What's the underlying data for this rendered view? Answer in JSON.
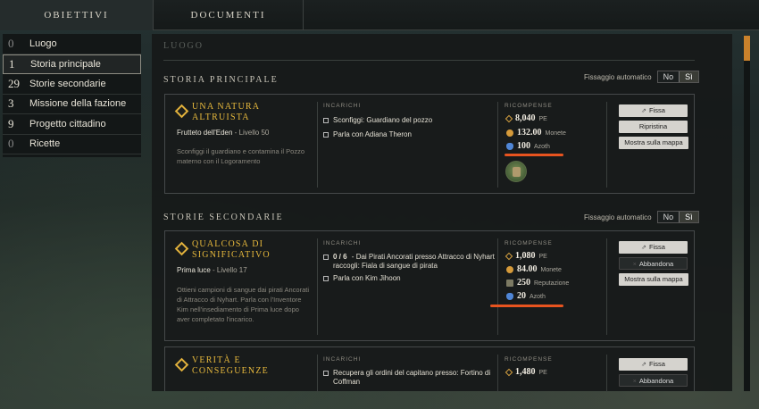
{
  "tabs": {
    "objectives": "OBIETTIVI",
    "documents": "DOCUMENTI"
  },
  "sidebar": {
    "items": [
      {
        "count": "0",
        "label": "Luogo"
      },
      {
        "count": "1",
        "label": "Storia principale"
      },
      {
        "count": "29",
        "label": "Storie secondarie"
      },
      {
        "count": "3",
        "label": "Missione della fazione"
      },
      {
        "count": "9",
        "label": "Progetto cittadino"
      },
      {
        "count": "0",
        "label": "Ricette"
      }
    ]
  },
  "sections": {
    "location": "LUOGO",
    "main_story": "STORIA PRINCIPALE",
    "side_stories": "STORIE SECONDARIE"
  },
  "autopin": {
    "label": "Fissaggio automatico",
    "no": "No",
    "yes": "Sì"
  },
  "columns": {
    "tasks": "INCARICHI",
    "rewards": "RICOMPENSE"
  },
  "quests": [
    {
      "title_line1": "UNA NATURA",
      "title_line2": "ALTRUISTA",
      "location": "Frutteto dell'Eden",
      "level": " - Livello 50",
      "desc": "Sconfiggi il guardiano e contamina il Pozzo materno con il Logoramento",
      "tasks": [
        {
          "prefix": "",
          "text": "Sconfiggi: Guardiano del pozzo"
        },
        {
          "prefix": "",
          "text": "Parla con Adiana Theron"
        }
      ],
      "rewards": [
        {
          "icon": "xp-icon",
          "value": "8,040",
          "unit": "PE"
        },
        {
          "icon": "coin-icon",
          "value": "132.00",
          "unit": "Monete"
        },
        {
          "icon": "azoth-icon",
          "value": "100",
          "unit": "Azoth"
        }
      ],
      "buttons": {
        "pin": "Fissa",
        "second": "Ripristina",
        "map": "Mostra sulla mappa"
      }
    },
    {
      "title_line1": "QUALCOSA DI",
      "title_line2": "SIGNIFICATIVO",
      "location": "Prima luce",
      "level": " - Livello 17",
      "desc": "Ottieni campioni di sangue dai pirati Ancorati di Attracco di Nyhart. Parla con l'Inventore Kim nell'insediamento di Prima luce dopo aver completato l'incarico.",
      "tasks": [
        {
          "prefix": "0 / 6",
          "text": " - Dai Pirati Ancorati presso Attracco di Nyhart raccogli: Fiala di sangue di pirata"
        },
        {
          "prefix": "",
          "text": "Parla con Kim Jihoon"
        }
      ],
      "rewards": [
        {
          "icon": "xp-icon",
          "value": "1,080",
          "unit": "PE"
        },
        {
          "icon": "coin-icon",
          "value": "84.00",
          "unit": "Monete"
        },
        {
          "icon": "reputation-icon",
          "value": "250",
          "unit": "Reputazione"
        },
        {
          "icon": "azoth-icon",
          "value": "20",
          "unit": "Azoth"
        }
      ],
      "buttons": {
        "pin": "Fissa",
        "second": "Abbandona",
        "map": "Mostra sulla mappa"
      }
    },
    {
      "title_line1": "VERITÀ E",
      "title_line2": "CONSEGUENZE",
      "tasks": [
        {
          "prefix": "",
          "text": "Recupera gli ordini del capitano presso: Fortino di Coffman"
        }
      ],
      "rewards": [
        {
          "icon": "xp-icon",
          "value": "1,480",
          "unit": "PE"
        }
      ],
      "buttons": {
        "pin": "Fissa",
        "second": "Abbandona"
      }
    }
  ],
  "colors": {
    "accent": "#e7b93c",
    "highlight": "#e8541f",
    "scroll": "#c9812b"
  }
}
